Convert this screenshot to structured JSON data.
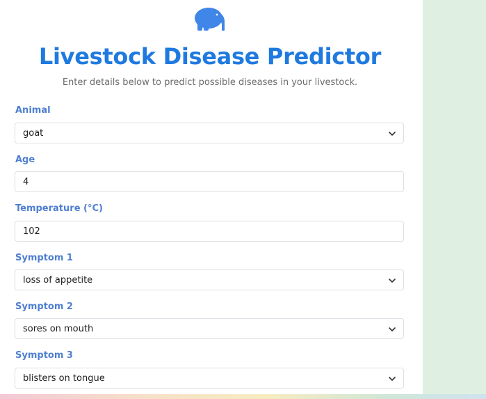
{
  "header": {
    "title": "Livestock Disease Predictor",
    "subtitle": "Enter details below to predict possible diseases in your livestock.",
    "logo_icon": "elephant-icon"
  },
  "form": {
    "animal": {
      "label": "Animal",
      "value": "goat",
      "type": "select"
    },
    "age": {
      "label": "Age",
      "value": "4",
      "type": "input"
    },
    "temperature": {
      "label": "Temperature (°C)",
      "value": "102",
      "type": "input"
    },
    "symptom1": {
      "label": "Symptom 1",
      "value": "loss of appetite",
      "type": "select"
    },
    "symptom2": {
      "label": "Symptom 2",
      "value": "sores on mouth",
      "type": "select"
    },
    "symptom3": {
      "label": "Symptom 3",
      "value": "blisters on tongue",
      "type": "select"
    }
  },
  "colors": {
    "title": "#1f7ae0",
    "label": "#4f7fd0",
    "background": "#dff0e2"
  }
}
